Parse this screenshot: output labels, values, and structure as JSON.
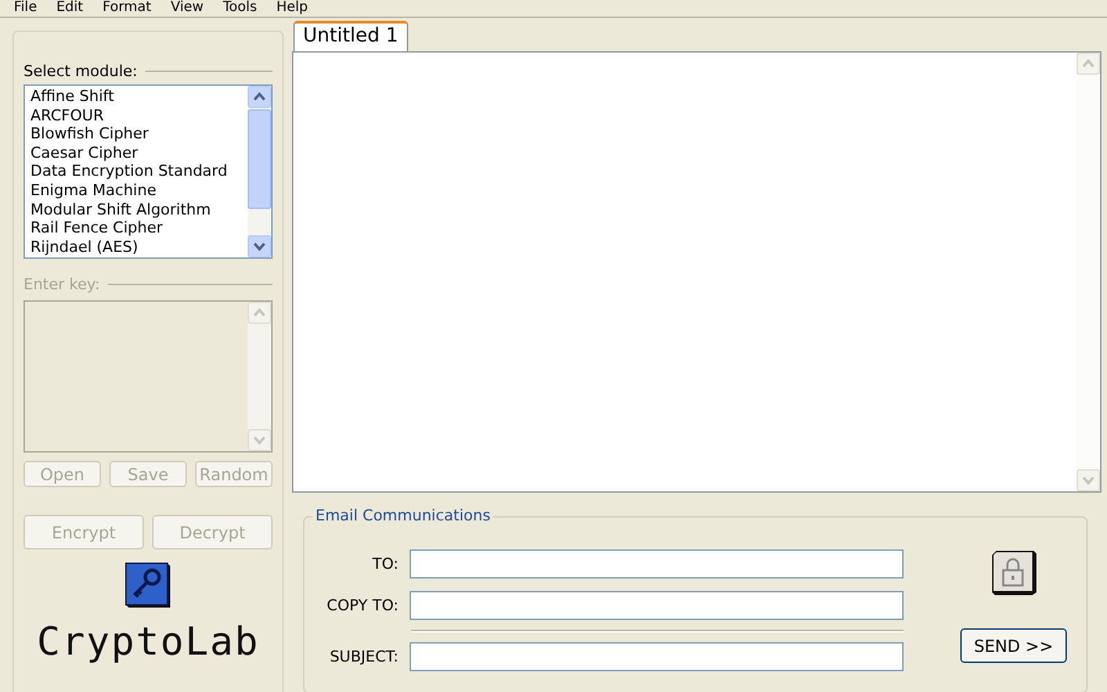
{
  "menu": [
    "File",
    "Edit",
    "Format",
    "View",
    "Tools",
    "Help"
  ],
  "module_select": {
    "label": "Select module:",
    "items": [
      {
        "label": "Affine Shift",
        "selected": false
      },
      {
        "label": "ARCFOUR",
        "selected": false
      },
      {
        "label": "Blowfish Cipher",
        "selected": false
      },
      {
        "label": "Caesar Cipher",
        "selected": false
      },
      {
        "label": "Data Encryption Standard",
        "selected": false
      },
      {
        "label": "Enigma Machine",
        "selected": false
      },
      {
        "label": "Modular Shift Algorithm",
        "selected": false
      },
      {
        "label": "Rail Fence Cipher",
        "selected": false
      },
      {
        "label": "Rijndael (AES)",
        "selected": false
      }
    ]
  },
  "key_entry": {
    "label": "Enter key:",
    "disabled": true
  },
  "key_buttons": [
    {
      "label": "Open",
      "disabled": true
    },
    {
      "label": "Save",
      "disabled": true
    },
    {
      "label": "Random",
      "disabled": true
    }
  ],
  "action_buttons": [
    {
      "label": "Encrypt",
      "disabled": true
    },
    {
      "label": "Decrypt",
      "disabled": true
    }
  ],
  "logo": {
    "text": "CryptoLab"
  },
  "tabs": [
    {
      "label": "Untitled 1",
      "selected": true
    }
  ],
  "email": {
    "title": "Email Communications",
    "fields": [
      {
        "label": "TO:"
      },
      {
        "label": "COPY TO:"
      },
      {
        "label": "SUBJECT:"
      }
    ],
    "send_button": "SEND >>"
  }
}
